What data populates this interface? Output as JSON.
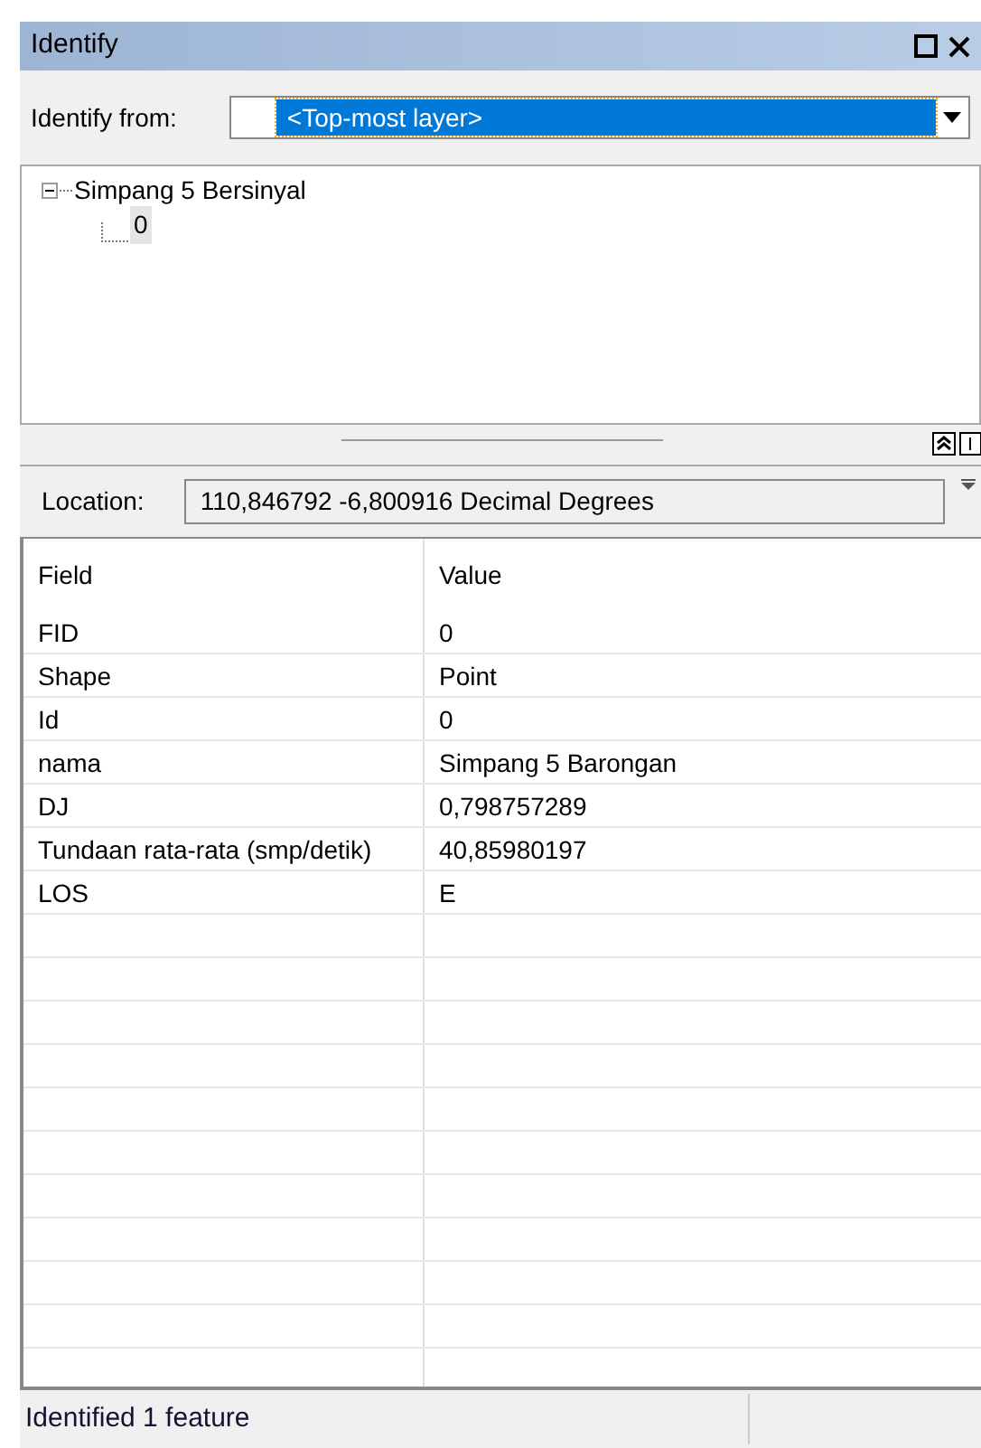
{
  "window": {
    "title": "Identify"
  },
  "identify_from": {
    "label": "Identify from:",
    "value": "<Top-most layer>"
  },
  "tree": [
    {
      "label": "Simpang 5 Bersinyal",
      "expanded": true,
      "children": [
        {
          "label": "0",
          "selected": true
        }
      ]
    }
  ],
  "location": {
    "label": "Location:",
    "value": "110,846792  -6,800916 Decimal Degrees"
  },
  "table": {
    "columns": [
      "Field",
      "Value"
    ],
    "rows": [
      [
        "FID",
        "0"
      ],
      [
        "Shape",
        "Point"
      ],
      [
        "Id",
        "0"
      ],
      [
        "nama",
        "Simpang 5 Barongan"
      ],
      [
        "DJ",
        "0,798757289"
      ],
      [
        "Tundaan rata-rata (smp/detik)",
        "40,85980197"
      ],
      [
        "LOS",
        "E"
      ]
    ]
  },
  "status_bar": {
    "text": "Identified 1 feature"
  }
}
